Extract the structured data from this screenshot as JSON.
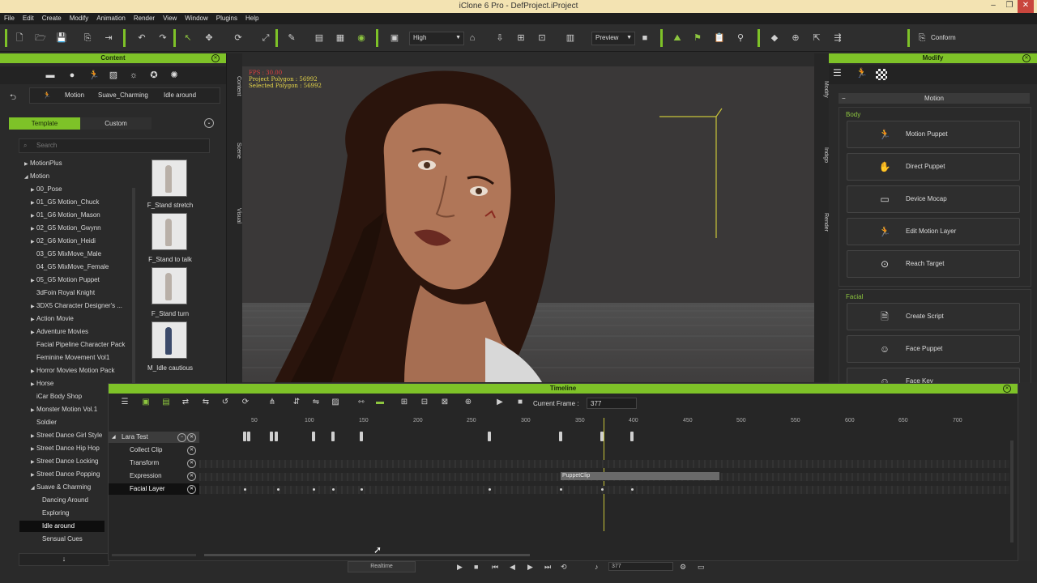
{
  "window": {
    "title": "iClone 6 Pro - DefProject.iProject"
  },
  "menu": [
    "File",
    "Edit",
    "Create",
    "Modify",
    "Animation",
    "Render",
    "View",
    "Window",
    "Plugins",
    "Help"
  ],
  "toolbar": {
    "quality": "High",
    "preview": "Preview",
    "conform": "Conform"
  },
  "content_panel": {
    "title": "Content",
    "breadcrumb": [
      "Motion",
      "Suave_Charming",
      "Idle around"
    ],
    "tabs": [
      "Template",
      "Custom"
    ],
    "search_placeholder": "Search",
    "tree": [
      "MotionPlus",
      "Motion",
      "00_Pose",
      "01_G5 Motion_Chuck",
      "01_G6 Motion_Mason",
      "02_G5 Motion_Gwynn",
      "02_G6 Motion_Heidi",
      "03_G5 MixMove_Male",
      "04_G5 MixMove_Female",
      "05_G5 Motion Puppet",
      "3dFoin Royal Knight",
      "3DX5 Character Designer's ...",
      "Action Movie",
      "Adventure Movies",
      "Facial Pipeline Character Pack",
      "Feminine Movement Vol1",
      "Horror Movies Motion Pack",
      "Horse",
      "iCar Body Shop",
      "Monster Motion Vol.1",
      "Soldier",
      "Street Dance Girl Style",
      "Street Dance Hip Hop",
      "Street Dance Locking",
      "Street Dance Popping",
      "Suave & Charming",
      "Dancing Around",
      "Exploring",
      "Idle around",
      "Sensual Cues"
    ],
    "thumbnails": [
      "F_Stand stretch",
      "F_Stand to talk",
      "F_Stand turn",
      "M_Idle cautious"
    ]
  },
  "side_tabs_left": [
    "Content",
    "Scene",
    "Visual"
  ],
  "side_tabs_right": [
    "Modify",
    "Indigo",
    "Render"
  ],
  "viewport": {
    "fps": "FPS : 30.00",
    "project_polygon": "Project Polygon : 56992",
    "selected_polygon": "Selected Polygon : 56992"
  },
  "modify_panel": {
    "title": "Modify",
    "section": "Motion",
    "body_group": "Body",
    "facial_group": "Facial",
    "body_buttons": [
      {
        "label": "Motion Puppet",
        "icon": "motion-puppet-icon"
      },
      {
        "label": "Direct Puppet",
        "icon": "direct-puppet-icon"
      },
      {
        "label": "Device Mocap",
        "icon": "device-mocap-icon"
      },
      {
        "label": "Edit Motion Layer",
        "icon": "edit-motion-layer-icon"
      },
      {
        "label": "Reach Target",
        "icon": "reach-target-icon"
      }
    ],
    "facial_buttons": [
      {
        "label": "Create Script",
        "icon": "create-script-icon"
      },
      {
        "label": "Face Puppet",
        "icon": "face-puppet-icon"
      },
      {
        "label": "Face Key",
        "icon": "face-key-icon"
      }
    ]
  },
  "timeline": {
    "title": "Timeline",
    "current_frame_label": "Current Frame :",
    "current_frame": "377",
    "ruler": [
      "50",
      "100",
      "150",
      "200",
      "250",
      "300",
      "350",
      "400",
      "450",
      "500",
      "550",
      "600",
      "650",
      "700"
    ],
    "tracks": [
      "Lara Test",
      "Collect Clip",
      "Transform",
      "Expression",
      "Facial Layer"
    ],
    "clip_label": "PuppetClip"
  },
  "playback": {
    "mode": "Realtime",
    "frame": "377"
  }
}
